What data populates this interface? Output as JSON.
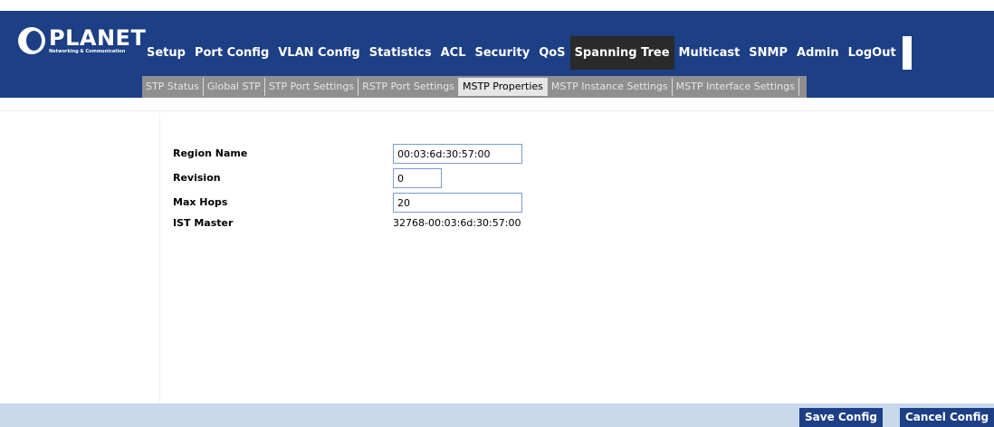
{
  "logo": {
    "brand": "PLANET",
    "tagline": "Networking & Communication"
  },
  "main_nav": {
    "items": [
      {
        "label": "Setup",
        "active": false
      },
      {
        "label": "Port Config",
        "active": false
      },
      {
        "label": "VLAN Config",
        "active": false
      },
      {
        "label": "Statistics",
        "active": false
      },
      {
        "label": "ACL",
        "active": false
      },
      {
        "label": "Security",
        "active": false
      },
      {
        "label": "QoS",
        "active": false
      },
      {
        "label": "Spanning Tree",
        "active": true
      },
      {
        "label": "Multicast",
        "active": false
      },
      {
        "label": "SNMP",
        "active": false
      },
      {
        "label": "Admin",
        "active": false
      },
      {
        "label": "LogOut",
        "active": false
      }
    ]
  },
  "sub_nav": {
    "items": [
      {
        "label": "STP Status",
        "active": false
      },
      {
        "label": "Global STP",
        "active": false
      },
      {
        "label": "STP Port Settings",
        "active": false
      },
      {
        "label": "RSTP Port Settings",
        "active": false
      },
      {
        "label": "MSTP Properties",
        "active": true
      },
      {
        "label": "MSTP Instance Settings",
        "active": false
      },
      {
        "label": "MSTP Interface Settings",
        "active": false
      }
    ]
  },
  "form": {
    "region_name": {
      "label": "Region Name",
      "value": "00:03:6d:30:57:00"
    },
    "revision": {
      "label": "Revision",
      "value": "0"
    },
    "max_hops": {
      "label": "Max Hops",
      "value": "20"
    },
    "ist_master": {
      "label": "IST Master",
      "value": "32768-00:03:6d:30:57:00"
    }
  },
  "footer": {
    "save_label": "Save Config",
    "cancel_label": "Cancel Config"
  },
  "colors": {
    "brand_blue": "#1c3f86",
    "active_tab": "#2a2a2a",
    "sub_nav_bg": "#8f8f8f",
    "footer_bg": "#c6d8ea"
  }
}
